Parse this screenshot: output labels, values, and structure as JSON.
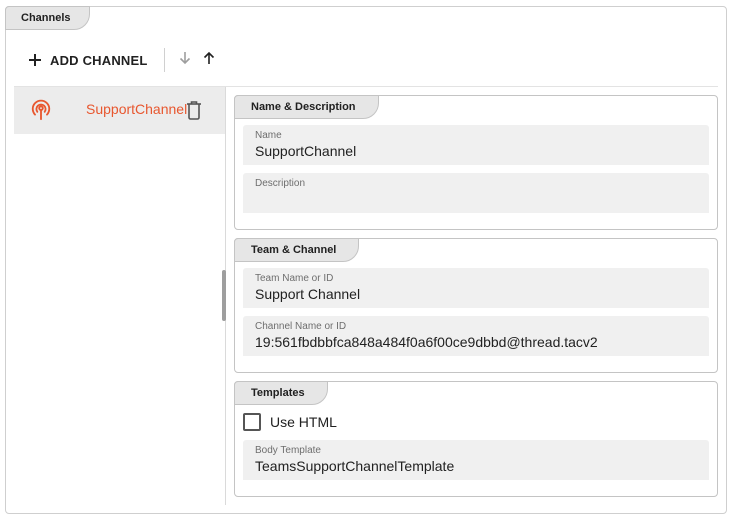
{
  "panel": {
    "title": "Channels"
  },
  "toolbar": {
    "add_label": "ADD CHANNEL",
    "add_icon": "plus-icon",
    "move_down_icon": "arrow-down-icon",
    "move_up_icon": "arrow-up-icon"
  },
  "channels": [
    {
      "name": "SupportChannel",
      "icon": "broadcast-icon",
      "delete_icon": "trash-icon",
      "selected": true
    }
  ],
  "colors": {
    "accent": "#e8572f",
    "selected_bg": "#ececec",
    "field_bg": "#f0f0f0"
  },
  "sections": {
    "name_description": {
      "title": "Name & Description",
      "name": {
        "label": "Name",
        "value": "SupportChannel"
      },
      "description": {
        "label": "Description",
        "value": ""
      }
    },
    "team_channel": {
      "title": "Team & Channel",
      "team": {
        "label": "Team Name or ID",
        "value": "Support Channel"
      },
      "channel": {
        "label": "Channel Name or ID",
        "value": "19:561fbdbbfca848a484f0a6f00ce9dbbd@thread.tacv2"
      }
    },
    "templates": {
      "title": "Templates",
      "use_html": {
        "label": "Use HTML",
        "checked": false
      },
      "body": {
        "label": "Body Template",
        "value": "TeamsSupportChannelTemplate"
      }
    }
  }
}
